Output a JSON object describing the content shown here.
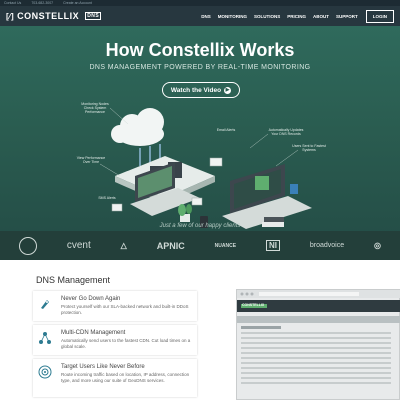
{
  "topbar": {
    "contact": "Contact Us",
    "phone": "703-682-3007",
    "account": "Create an Account"
  },
  "nav": {
    "logo_text": "CONSTELLIX",
    "logo_sub": "DNS",
    "menu": [
      "DNS",
      "MONITORING",
      "SOLUTIONS",
      "PRICING",
      "ABOUT",
      "SUPPORT"
    ],
    "login": "LOGIN"
  },
  "hero": {
    "title": "How Constellix Works",
    "subtitle": "DNS MANAGEMENT POWERED BY REAL-TIME MONITORING",
    "video_button": "Watch the Video",
    "callouts": {
      "monitoring": "Monitoring Nodes Check System Performance",
      "view_perf": "View Performance Over Time",
      "sms": "SMS Alerts",
      "email": "Email Alerts",
      "auto_update": "Automatically Updates Your DNS Records",
      "users_sent": "Users Sent to Fastest Systems"
    }
  },
  "clients": {
    "caption": "Just a few of our happy clients",
    "logos": [
      "cvent",
      "APNIC",
      "NUANCE",
      "NI",
      "broadvoice"
    ]
  },
  "dns_section": {
    "title": "DNS Management",
    "features": [
      {
        "icon": "rocket-icon",
        "title": "Never Go Down Again",
        "desc": "Protect yourself with our SLA-backed network and built-in DDoS protection."
      },
      {
        "icon": "network-icon",
        "title": "Multi-CDN Management",
        "desc": "Automatically send users to the fastest CDN. Cut load times on a global scale."
      },
      {
        "icon": "target-icon",
        "title": "Target Users Like Never Before",
        "desc": "Route incoming traffic based on location, IP address, connection type, and more using our suite of GeoDNS services."
      }
    ],
    "browser_logo": "CONSTELLIX"
  },
  "colors": {
    "nav_bg": "#27373f",
    "hero_bg": "#2a5c50",
    "accent": "#2d7b91"
  }
}
